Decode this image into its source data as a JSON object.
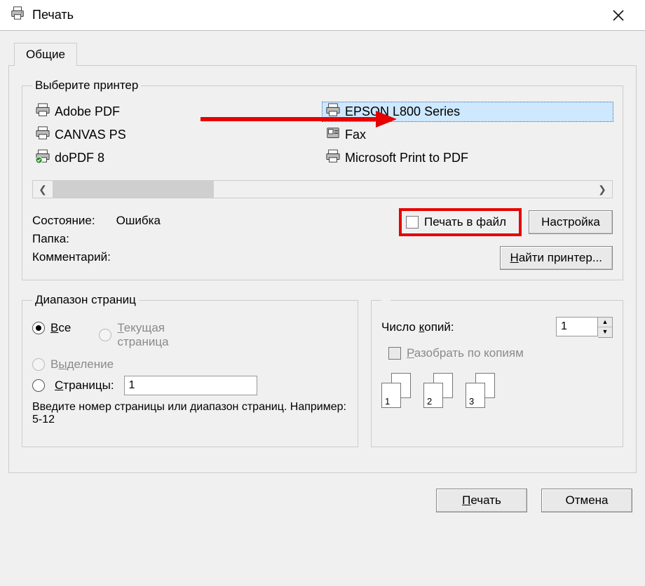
{
  "window": {
    "title": "Печать"
  },
  "tabs": {
    "general": "Общие"
  },
  "printerGroup": {
    "legend": "Выберите принтер",
    "left": [
      {
        "label": "Adobe PDF"
      },
      {
        "label": "CANVAS PS"
      },
      {
        "label": "doPDF 8"
      }
    ],
    "right": [
      {
        "label": "EPSON L800 Series",
        "selected": true
      },
      {
        "label": "Fax"
      },
      {
        "label": "Microsoft Print to PDF"
      }
    ],
    "status_label": "Состояние:",
    "status_value": "Ошибка",
    "folder_label": "Папка:",
    "comment_label": "Комментарий:",
    "print_to_file": "Печать в файл",
    "settings_btn": "Настройка",
    "find_printer_btn": "Найти принтер..."
  },
  "range": {
    "legend": "Диапазон страниц",
    "all": "Все",
    "current": "Текущая страница",
    "selection": "Выделение",
    "pages": "Страницы:",
    "pages_value": "1",
    "hint": "Введите номер страницы или диапазон страниц. Например: 5-12"
  },
  "copies": {
    "count_label": "Число копий:",
    "count_value": "1",
    "collate_label": "Разобрать по копиям",
    "stack_labels": [
      "1",
      "2",
      "3"
    ]
  },
  "buttons": {
    "print": "Печать",
    "cancel": "Отмена"
  }
}
